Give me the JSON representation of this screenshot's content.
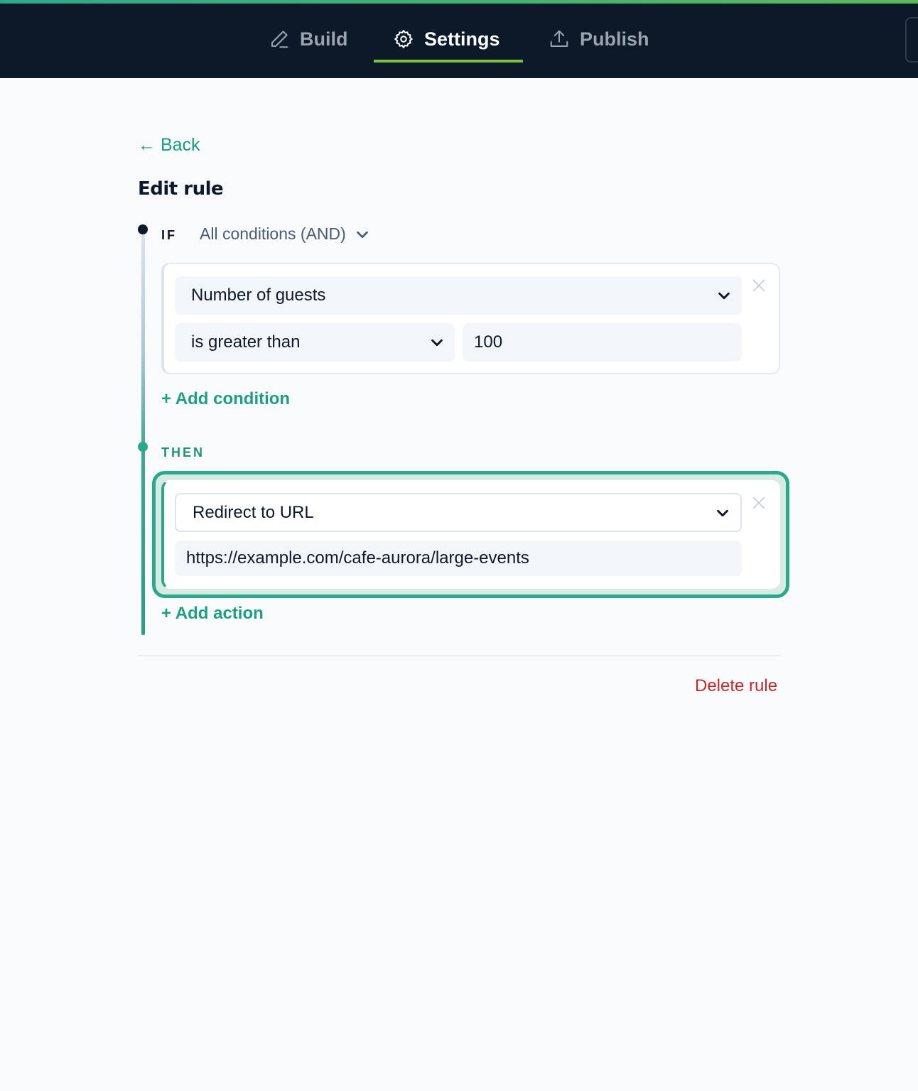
{
  "nav": {
    "tabs": [
      {
        "label": "Build",
        "icon": "pencil-icon",
        "active": false
      },
      {
        "label": "Settings",
        "icon": "gear-icon",
        "active": true
      },
      {
        "label": "Publish",
        "icon": "upload-icon",
        "active": false
      }
    ],
    "accent_color": "#7ec13a"
  },
  "page": {
    "back_label": "← Back",
    "title": "Edit rule"
  },
  "rule": {
    "if_label": "IF",
    "match_mode": "All conditions (AND)",
    "condition": {
      "field": "Number of guests",
      "operator": "is greater than",
      "value": "100"
    },
    "add_condition_label": "+ Add condition",
    "then_label": "THEN",
    "action": {
      "type": "Redirect to URL",
      "url": "https://example.com/cafe-aurora/large-events"
    },
    "add_action_label": "+ Add action",
    "delete_label": "Delete rule"
  },
  "colors": {
    "brand": "#1f9e80",
    "danger": "#c4292a",
    "header_bg": "#0c1929"
  }
}
